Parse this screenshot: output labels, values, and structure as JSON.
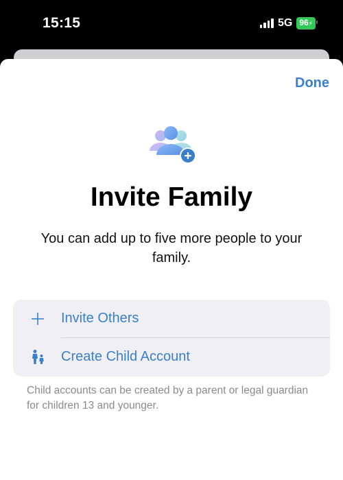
{
  "status_bar": {
    "time": "15:15",
    "network": "5G",
    "battery": "96"
  },
  "header": {
    "done_label": "Done"
  },
  "main": {
    "title": "Invite Family",
    "subtitle": "You can add up to five more people to your family."
  },
  "options": [
    {
      "label": "Invite Others",
      "icon": "plus-icon"
    },
    {
      "label": "Create Child Account",
      "icon": "adult-child-icon"
    }
  ],
  "footnote": "Child accounts can be created by a parent or legal guardian for children 13 and younger.",
  "colors": {
    "accent": "#3a7fc9",
    "battery": "#34c759",
    "group_background": "#efeff4",
    "footnote_text": "#8a8a8e"
  }
}
